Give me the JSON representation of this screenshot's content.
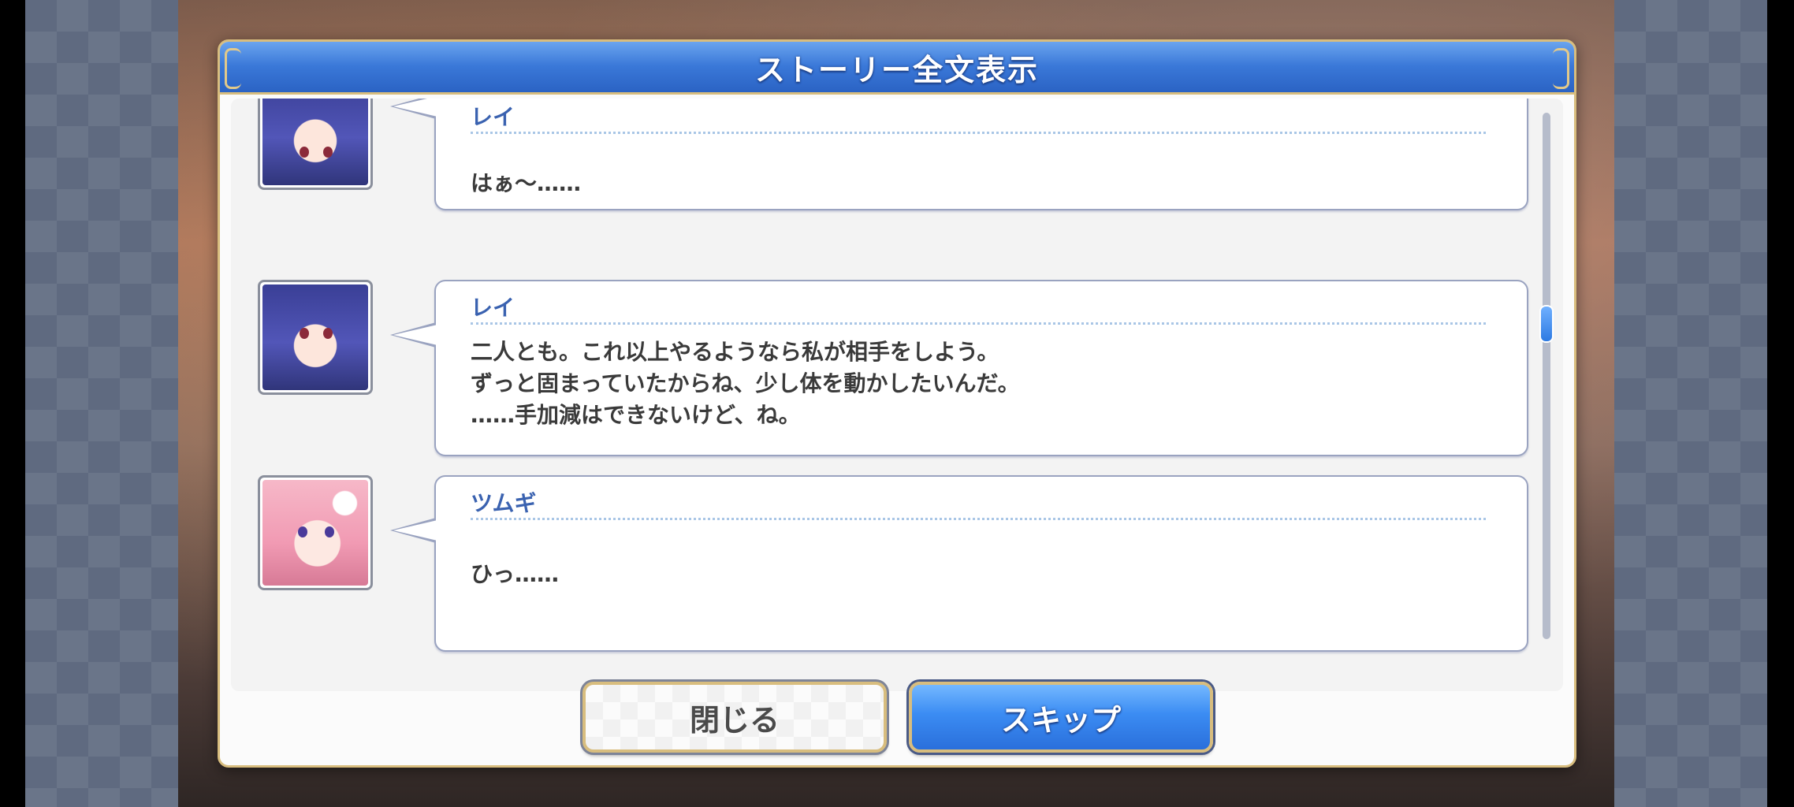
{
  "dialog": {
    "title": "ストーリー全文表示"
  },
  "log": [
    {
      "speaker": "レイ",
      "portrait_icon": "rei-portrait-icon",
      "lines": [
        "はぁ～……"
      ]
    },
    {
      "speaker": "レイ",
      "portrait_icon": "rei-portrait-icon",
      "lines": [
        "二人とも。これ以上やるようなら私が相手をしよう。",
        "ずっと固まっていたからね、少し体を動かしたいんだ。",
        "……手加減はできないけど、ね。"
      ]
    },
    {
      "speaker": "ツムギ",
      "portrait_icon": "tsumugi-portrait-icon",
      "lines": [
        "ひっ……"
      ]
    }
  ],
  "buttons": {
    "close_label": "閉じる",
    "skip_label": "スキップ"
  },
  "colors": {
    "title_bar": "#3a78d8",
    "frame_gold": "#d8bd7e",
    "speaker_name": "#3a62b0",
    "skip_button": "#3b8cf3"
  }
}
